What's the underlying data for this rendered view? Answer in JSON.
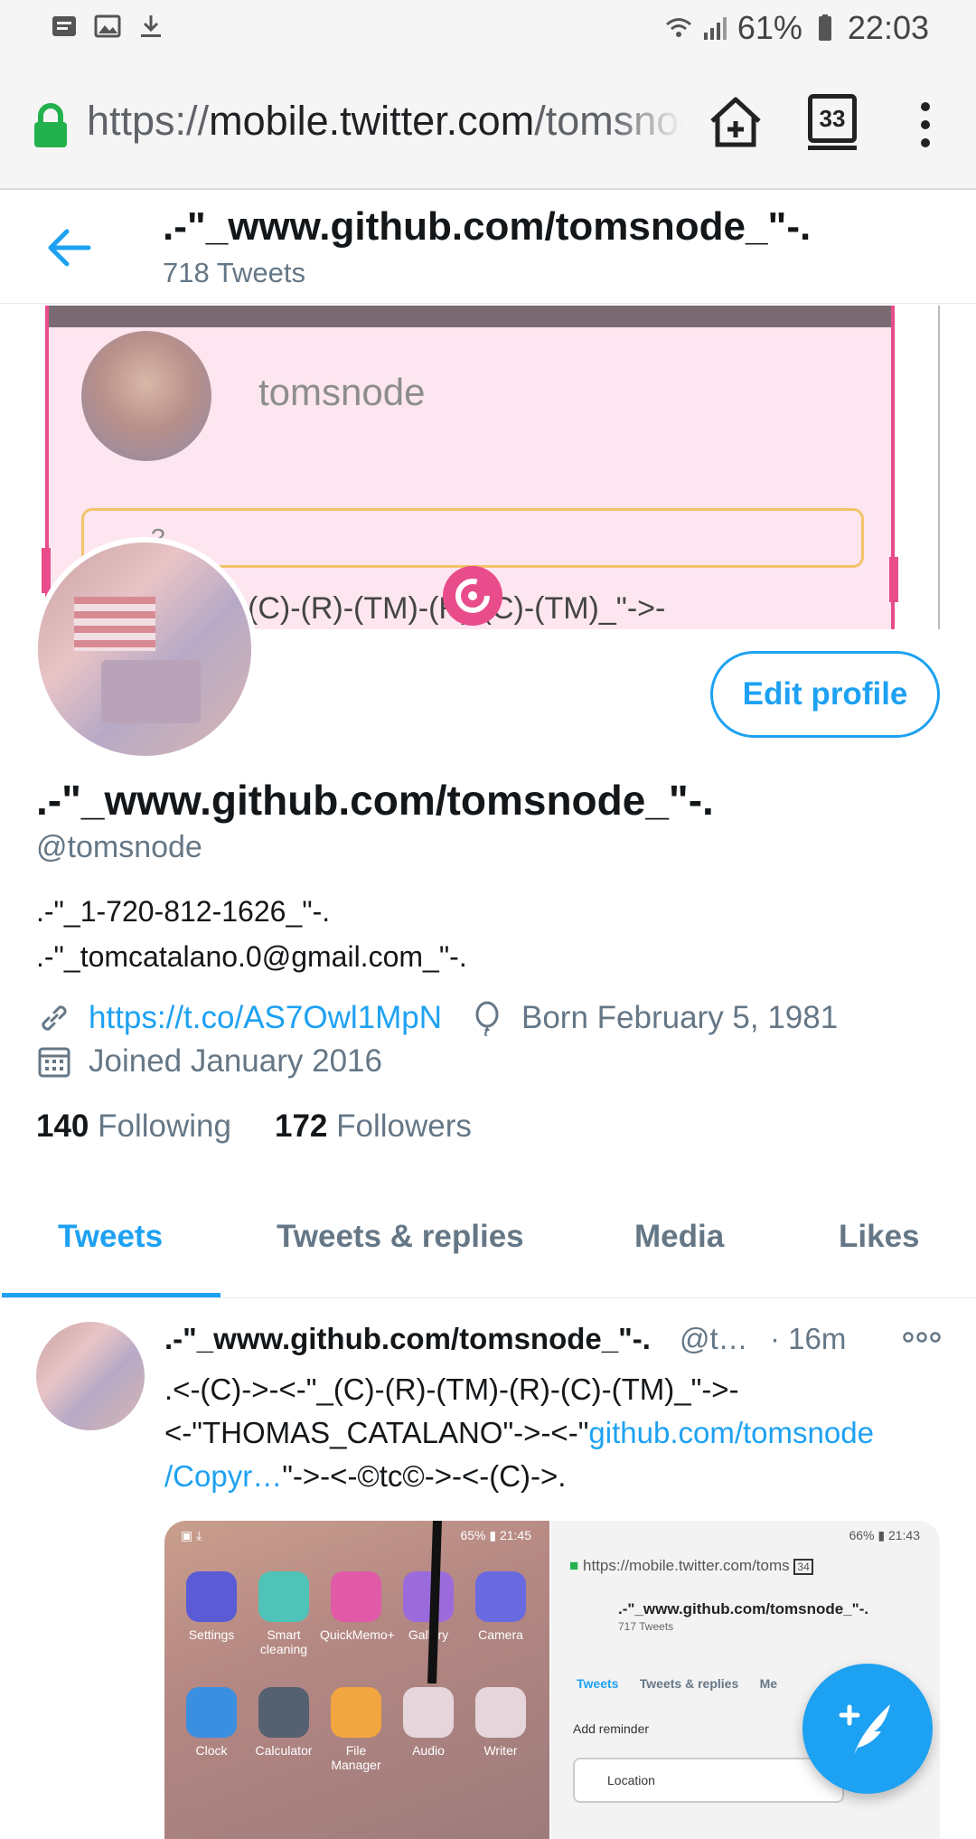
{
  "status_bar": {
    "battery": "61%",
    "time": "22:03"
  },
  "browser": {
    "url_scheme": "https://",
    "url_host": "mobile.twitter.com",
    "url_path": "/tomsnode",
    "tab_count": "33"
  },
  "header": {
    "title": ".-\"_www.github.com/tomsnode_\"-.",
    "tweet_count": "718 Tweets"
  },
  "banner": {
    "name": "tomsnode",
    "box_text": "?",
    "text": "(C)-(R)-(TM)-(R)-(C)-(TM)_\"->-"
  },
  "profile": {
    "edit_label": "Edit profile",
    "name": ".-\"_www.github.com/tomsnode_\"-.",
    "handle": "@tomsnode",
    "bio_line1": ".-\"_1-720-812-1626_\"-.",
    "bio_line2": ".-\"_tomcatalano.0@gmail.com_\"-.",
    "link": "https://t.co/AS7Owl1MpN",
    "birthday": "Born February 5, 1981",
    "joined": "Joined January 2016",
    "following_count": "140",
    "following_label": "Following",
    "followers_count": "172",
    "followers_label": "Followers"
  },
  "tabs": [
    {
      "label": "Tweets"
    },
    {
      "label": "Tweets & replies"
    },
    {
      "label": "Media"
    },
    {
      "label": "Likes"
    }
  ],
  "tweet": {
    "name": ".-\"_www.github.com/tomsnode_\"-.",
    "handle": "@t…",
    "time": "· 16m",
    "line1": ".<-(C)->-<-\"_(C)-(R)-(TM)-(R)-(C)-(TM)_\"->-",
    "line2_text": "<-\"THOMAS_CATALANO\"->-<-\"",
    "line2_link": "github.com/tomsnode",
    "line3_link": "/Copyr…",
    "line3_text": "\"->-<-©tc©->-<-(C)->.",
    "media": {
      "left_status": "65% ▮ 21:45",
      "right_status": "66% ▮ 21:43",
      "apps": [
        "Settings",
        "Smart cleaning",
        "QuickMemo+",
        "Gallery",
        "Camera",
        "Clock",
        "Calculator",
        "File Manager",
        "Audio",
        "Writer"
      ],
      "url": "https://mobile.twitter.com/toms",
      "tab_count": "34",
      "title": ".-\"_www.github.com/tomsnode_\"-.",
      "sub": "717 Tweets",
      "tabs": [
        "Tweets",
        "Tweets & replies",
        "Me"
      ],
      "location_label": "Location",
      "reminder_label": "Add reminder"
    }
  },
  "colors": {
    "accent": "#1da1f2",
    "text": "#14171a",
    "muted": "#657786",
    "secure": "#22b14c"
  },
  "icons": [
    "notification-icon",
    "image-icon",
    "download-icon",
    "wifi-icon",
    "signal-icon",
    "battery-icon",
    "lock-icon",
    "home-icon",
    "more-vert-icon",
    "back-arrow-icon",
    "link-icon",
    "balloon-icon",
    "calendar-icon",
    "more-horiz-icon",
    "compose-icon"
  ]
}
